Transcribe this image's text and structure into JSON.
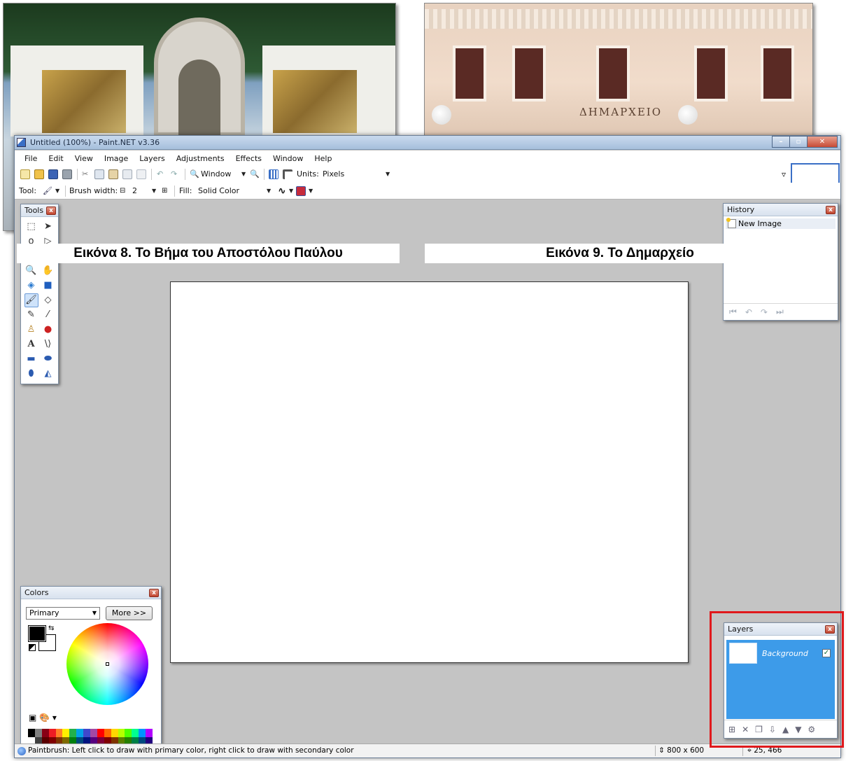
{
  "app": {
    "title": "Untitled (100%) - Paint.NET v3.36",
    "menu": [
      "File",
      "Edit",
      "View",
      "Image",
      "Layers",
      "Adjustments",
      "Effects",
      "Window",
      "Help"
    ],
    "toolbar1": {
      "window_label": "Window",
      "units_label": "Units:",
      "units_value": "Pixels"
    },
    "toolbar2": {
      "tool_label": "Tool:",
      "brush_width_label": "Brush width:",
      "brush_width_value": "2",
      "fill_label": "Fill:",
      "fill_value": "Solid Color"
    }
  },
  "tools_panel": {
    "title": "Tools"
  },
  "history_panel": {
    "title": "History",
    "items": [
      "New Image"
    ]
  },
  "colors_panel": {
    "title": "Colors",
    "mode": "Primary",
    "more_label": "More >>",
    "primary_color": "#000000",
    "secondary_color": "#ffffff",
    "palette": [
      "#000000",
      "#7f7f7f",
      "#880015",
      "#ed1c24",
      "#ff7f27",
      "#fff200",
      "#22b14c",
      "#00a2e8",
      "#3f48cc",
      "#a349a4",
      "#ff0000",
      "#ff6a00",
      "#ffd800",
      "#b6ff00",
      "#4cff00",
      "#00ff90",
      "#0094ff",
      "#b200ff",
      "#ffffff",
      "#404040",
      "#5a0000",
      "#7f0000",
      "#7f3300",
      "#7f6a00",
      "#007f0e",
      "#004a7f",
      "#00137f",
      "#57007f",
      "#7f0037",
      "#7f0000",
      "#7f3300",
      "#5b7f00",
      "#267f00",
      "#007f46",
      "#00497f",
      "#21007f"
    ]
  },
  "layers_panel": {
    "title": "Layers",
    "layers": [
      {
        "name": "Background",
        "visible": true
      }
    ]
  },
  "status": {
    "text": "Paintbrush: Left click to draw with primary color, right click to draw with secondary color",
    "image_size": "800 x 600",
    "cursor_pos": "25, 466"
  },
  "captions": {
    "left": "Εικόνα 8. Το Βήμα του Αποστόλου Παύλου",
    "right": "Εικόνα 9. Το Δημαρχείο"
  },
  "photo_right_sign": "ΔΗΜΑΡΧΕΙΟ",
  "accent_colors": {
    "highlight": "#e0191c",
    "selection": "#3d9be9"
  }
}
